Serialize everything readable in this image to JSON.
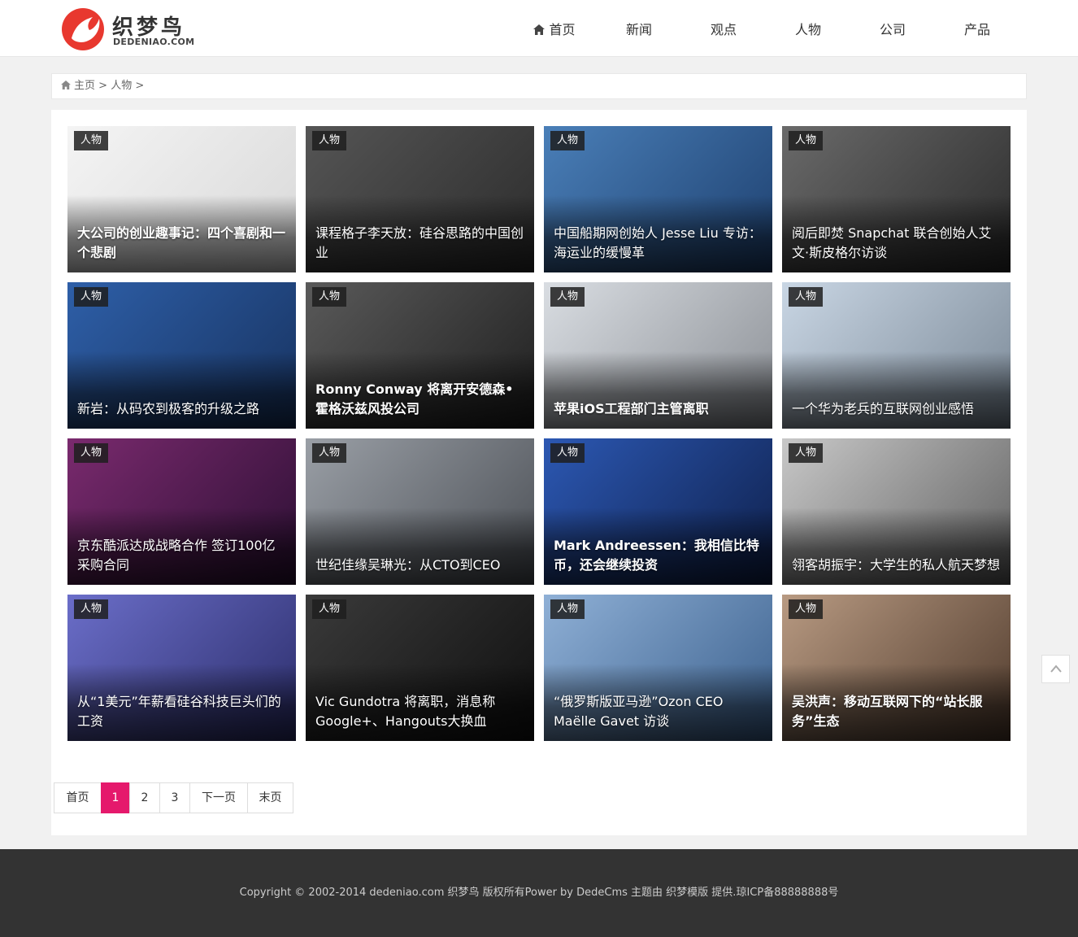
{
  "header": {
    "logo_cn": "织梦鸟",
    "logo_en": "DEDENIAO.COM",
    "nav": [
      {
        "label": "首页",
        "icon": "home-icon"
      },
      {
        "label": "新闻"
      },
      {
        "label": "观点"
      },
      {
        "label": "人物"
      },
      {
        "label": "公司"
      },
      {
        "label": "产品"
      }
    ]
  },
  "breadcrumb": {
    "home": "主页",
    "sep": ">",
    "current": "人物",
    "trail": ">"
  },
  "articles": [
    {
      "tag": "人物",
      "title": "大公司的创业趣事记：四个喜剧和一个悲剧",
      "bold": true
    },
    {
      "tag": "人物",
      "title": "课程格子李天放：硅谷思路的中国创业",
      "bold": false
    },
    {
      "tag": "人物",
      "title": "中国船期网创始人 Jesse Liu 专访：海运业的缓慢革",
      "bold": false
    },
    {
      "tag": "人物",
      "title": "阅后即焚 Snapchat 联合创始人艾文·斯皮格尔访谈",
      "bold": false
    },
    {
      "tag": "人物",
      "title": "新岩：从码农到极客的升级之路",
      "bold": false
    },
    {
      "tag": "人物",
      "title": "Ronny Conway 将离开安德森•霍格沃兹风投公司",
      "bold": true
    },
    {
      "tag": "人物",
      "title": "苹果iOS工程部门主管离职",
      "bold": true
    },
    {
      "tag": "人物",
      "title": "一个华为老兵的互联网创业感悟",
      "bold": false
    },
    {
      "tag": "人物",
      "title": "京东酷派达成战略合作 签订100亿采购合同",
      "bold": false
    },
    {
      "tag": "人物",
      "title": "世纪佳缘吴琳光：从CTO到CEO",
      "bold": false
    },
    {
      "tag": "人物",
      "title": "Mark Andreessen：我相信比特币，还会继续投资",
      "bold": true
    },
    {
      "tag": "人物",
      "title": "翎客胡振宇：大学生的私人航天梦想",
      "bold": false
    },
    {
      "tag": "人物",
      "title": "从“1美元”年薪看硅谷科技巨头们的工资",
      "bold": false
    },
    {
      "tag": "人物",
      "title": "Vic Gundotra 将离职，消息称Google+、Hangouts大换血",
      "bold": false
    },
    {
      "tag": "人物",
      "title": "“俄罗斯版亚马逊”Ozon CEO Maëlle Gavet 访谈",
      "bold": false
    },
    {
      "tag": "人物",
      "title": "吴洪声：移动互联网下的“站长服务”生态",
      "bold": true
    }
  ],
  "pagination": [
    {
      "label": "首页",
      "active": false
    },
    {
      "label": "1",
      "active": true
    },
    {
      "label": "2",
      "active": false
    },
    {
      "label": "3",
      "active": false
    },
    {
      "label": "下一页",
      "active": false
    },
    {
      "label": "末页",
      "active": false
    }
  ],
  "footer": {
    "text": "Copyright © 2002-2014 dedeniao.com 织梦鸟 版权所有Power by DedeCms 主题由 织梦模版 提供.琼ICP备88888888号"
  },
  "colors": {
    "accent": "#e5196c",
    "footer_bg": "#333333",
    "logo_red": "#e8382f"
  }
}
